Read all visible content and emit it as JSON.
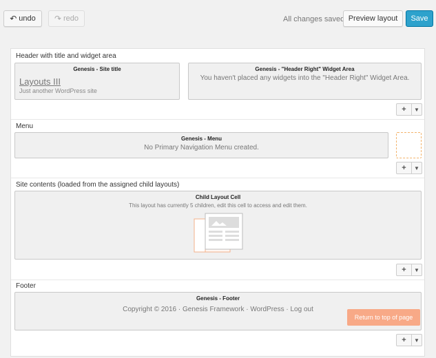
{
  "toolbar": {
    "undo_label": "undo",
    "redo_label": "redo",
    "status": "All changes saved",
    "preview_label": "Preview layout",
    "save_label": "Save"
  },
  "rows": [
    {
      "title": "Header with title and widget area",
      "cells": [
        {
          "head": "Genesis - Site title",
          "title": "Layouts III",
          "desc": "Just another WordPress site"
        },
        {
          "head": "Genesis - \"Header Right\" Widget Area",
          "text": "You haven't placed any widgets into the \"Header Right\" Widget Area."
        }
      ]
    },
    {
      "title": "Menu",
      "cells": [
        {
          "head": "Genesis - Menu",
          "text": "No Primary Navigation Menu created."
        }
      ]
    },
    {
      "title": "Site contents (loaded from the assigned child layouts)",
      "cells": [
        {
          "head": "Child Layout Cell",
          "text": "This layout has currently 5 children, edit this cell to access and edit them."
        }
      ]
    },
    {
      "title": "Footer",
      "cells": [
        {
          "head": "Genesis - Footer",
          "text": "Copyright © 2016 · Genesis Framework · WordPress · Log out",
          "button": "Return to top of page"
        }
      ]
    }
  ],
  "colors": {
    "accent": "#2ea2cc",
    "placeholder_border": "#f3b36b",
    "return_button": "#f8a987"
  }
}
